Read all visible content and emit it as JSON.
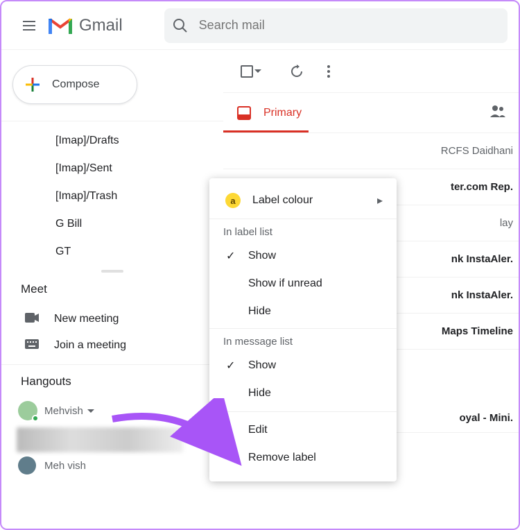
{
  "header": {
    "app_name": "Gmail",
    "search_placeholder": "Search mail"
  },
  "compose_label": "Compose",
  "sidebar_labels": [
    {
      "text": "[Imap]/Drafts",
      "color": "grey"
    },
    {
      "text": "[Imap]/Sent",
      "color": "grey"
    },
    {
      "text": "[Imap]/Trash",
      "color": "grey"
    },
    {
      "text": "G Bill",
      "color": "yellow"
    },
    {
      "text": "GT",
      "color": "purple"
    }
  ],
  "meet": {
    "title": "Meet",
    "new_meeting": "New meeting",
    "join_meeting": "Join a meeting"
  },
  "hangouts": {
    "title": "Hangouts",
    "user": "Mehvish",
    "contact_suffix": "nk",
    "contact2": "Meh vish"
  },
  "tabs": {
    "primary": "Primary"
  },
  "emails": [
    {
      "sender": "RCFS Daidhani",
      "bold": false
    },
    {
      "sender": "ter.com Rep.",
      "bold": true
    },
    {
      "sender": "lay",
      "bold": false
    },
    {
      "sender": "nk InstaAler.",
      "bold": true
    },
    {
      "sender": "nk InstaAler.",
      "bold": true
    },
    {
      "sender": "Maps Timeline",
      "bold": true
    },
    {
      "sender": "oyal - Mini.",
      "bold": true
    }
  ],
  "context_menu": {
    "label_colour": "Label colour",
    "label_chip": "a",
    "section1": "In label list",
    "section2": "In message list",
    "show": "Show",
    "show_unread": "Show if unread",
    "hide": "Hide",
    "edit": "Edit",
    "remove": "Remove label"
  }
}
